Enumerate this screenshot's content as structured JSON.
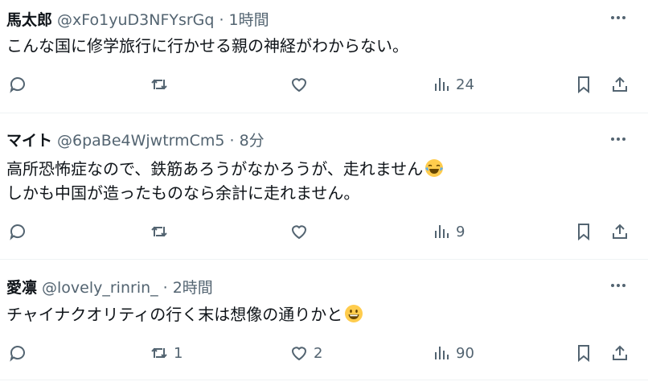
{
  "tweets": [
    {
      "name": "馬太郎",
      "handle": "@xFo1yuD3NFYsrGq",
      "time": "1時間",
      "lines": [
        "こんな国に修学旅行に行かせる親の神経がわからない。"
      ],
      "replies": "",
      "retweets": "",
      "likes": "",
      "views": "24"
    },
    {
      "name": "マイト",
      "handle": "@6paBe4WjwtrmCm5",
      "time": "8分",
      "lines": [
        "高所恐怖症なので、鉄筋あろうがなかろうが、走れません",
        "しかも中国が造ったものなら余計に走れません。"
      ],
      "emoji": "face-with-tears-of-joy",
      "replies": "",
      "retweets": "",
      "likes": "",
      "views": "9"
    },
    {
      "name": "愛凛",
      "handle": "@lovely_rinrin_",
      "time": "2時間",
      "lines": [
        "チャイナクオリティの行く末は想像の通りかと"
      ],
      "emoji": "grinning-face",
      "replies": "",
      "retweets": "1",
      "likes": "2",
      "views": "90"
    }
  ],
  "separator": "·"
}
